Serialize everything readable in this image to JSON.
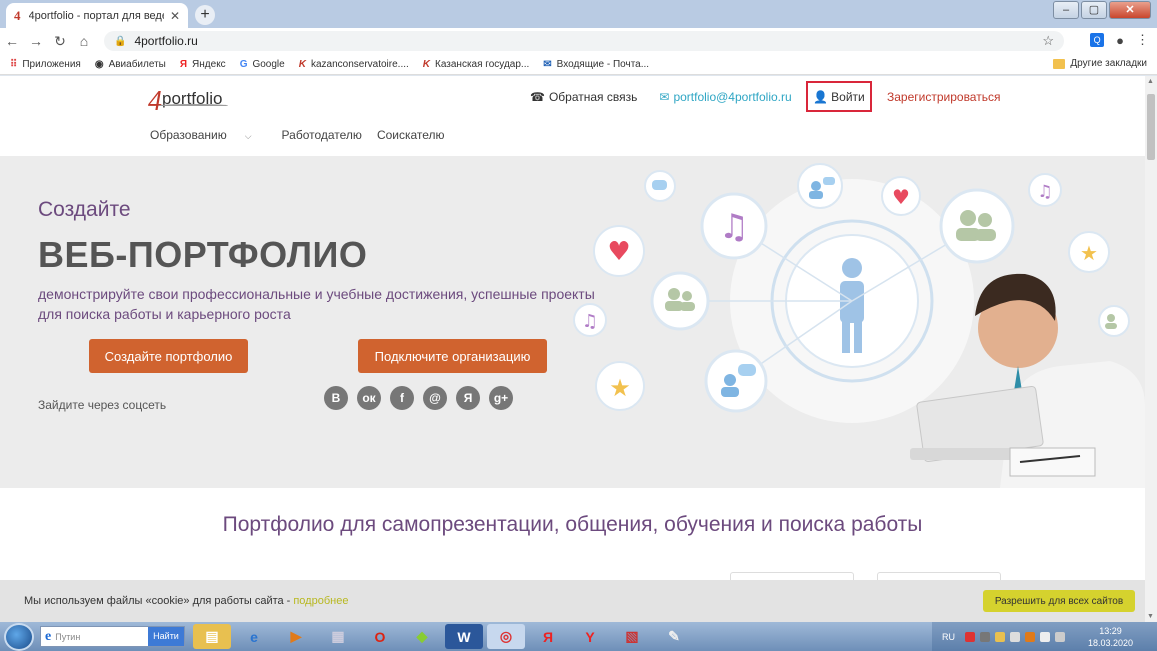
{
  "browser": {
    "tab_title": "4portfolio - портал для ведения",
    "tab_favicon": "4",
    "url": "4portfolio.ru",
    "bookmarks": [
      {
        "icon": "apps-icon",
        "label": "Приложения"
      },
      {
        "icon": "globe-icon",
        "label": "Авиабилеты"
      },
      {
        "icon": "yandex-icon",
        "label": "Яндекс"
      },
      {
        "icon": "google-icon",
        "label": "Google"
      },
      {
        "icon": "k-icon",
        "label": "kazanconservatoire...."
      },
      {
        "icon": "k-icon",
        "label": "Казанская государ..."
      },
      {
        "icon": "mail-icon",
        "label": "Входящие - Почта..."
      }
    ],
    "other_bookmarks": "Другие закладки"
  },
  "site": {
    "logo_text": "portfolio",
    "logo_digit": "4",
    "feedback": "Обратная связь",
    "email": "portfolio@4portfolio.ru",
    "login": "Войти",
    "register": "Зарегистрироваться",
    "nav": {
      "education": "Образованию",
      "employer": "Работодателю",
      "seeker": "Соискателю"
    }
  },
  "hero": {
    "subtitle": "Создайте",
    "title": "ВЕБ-ПОРТФОЛИО",
    "description": "демонстрируйте свои профессиональные и учебные достижения, успешные проекты для поиска работы и карьерного роста",
    "btn_create": "Создайте портфолио",
    "btn_connect": "Подключите организацию",
    "social_label": "Зайдите через соцсеть",
    "socials": [
      "B",
      "ок",
      "f",
      "@",
      "Я",
      "g+"
    ]
  },
  "tagline": "Портфолио для самопрезентации, общения, обучения и поиска работы",
  "cookie": {
    "text": "Мы используем файлы «cookie» для работы сайта -",
    "more": "подробнее",
    "accept": "Разрешить для всех сайтов"
  },
  "taskbar": {
    "search_placeholder": "Путин",
    "search_button": "Найти",
    "lang": "RU",
    "time": "13:29",
    "date": "18.03.2020"
  },
  "colors": {
    "accent_orange": "#d0632f",
    "purple_text": "#6c4a7e",
    "login_border": "#d9263a",
    "cookie_button": "#d5d22e"
  }
}
